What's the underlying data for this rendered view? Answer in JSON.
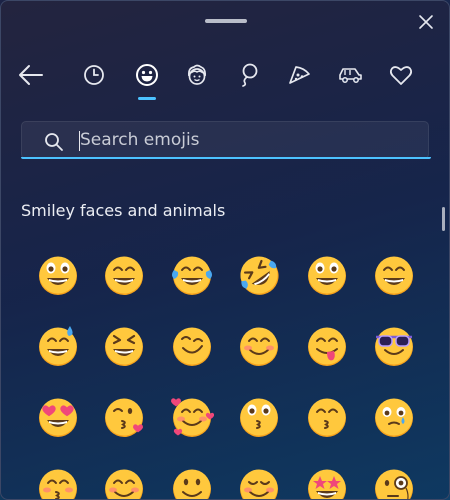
{
  "panel": {
    "close_icon": "close-icon",
    "drag_handle": "drag-handle"
  },
  "nav": {
    "items": [
      {
        "name": "back",
        "icon": "arrow-left-icon"
      },
      {
        "name": "recent",
        "icon": "clock-icon"
      },
      {
        "name": "smileys",
        "icon": "smiley-face-icon",
        "active": true
      },
      {
        "name": "people",
        "icon": "person-face-icon"
      },
      {
        "name": "celebration",
        "icon": "balloon-icon"
      },
      {
        "name": "food",
        "icon": "pizza-icon"
      },
      {
        "name": "travel",
        "icon": "car-icon"
      },
      {
        "name": "symbols",
        "icon": "heart-icon"
      }
    ]
  },
  "search": {
    "placeholder": "Search emojis",
    "value": ""
  },
  "section": {
    "title": "Smiley faces and animals"
  },
  "emojis": {
    "rows": [
      [
        "grinning-face",
        "beaming-face",
        "face-with-tears-of-joy",
        "rolling-on-floor-laughing",
        "grinning-face-big-eyes",
        "grinning-face-smiling-eyes"
      ],
      [
        "grinning-sweat",
        "squinting-face",
        "winking-face",
        "smiling-blushing-face",
        "face-savoring-food",
        "smiling-face-sunglasses"
      ],
      [
        "heart-eyes",
        "face-blowing-kiss",
        "smiling-face-hearts",
        "kissing-face",
        "kissing-face-closed-eyes",
        "face-holding-back-tears"
      ],
      [
        "kissing-smiling-eyes",
        "smiling-blushing-eyes",
        "slightly-smiling",
        "relieved-face",
        "star-struck",
        "face-with-monocle"
      ]
    ]
  },
  "colors": {
    "accent": "#4cc2ff",
    "emoji_yellow": "#ffc83d",
    "emoji_shade": "#f7a21b"
  }
}
